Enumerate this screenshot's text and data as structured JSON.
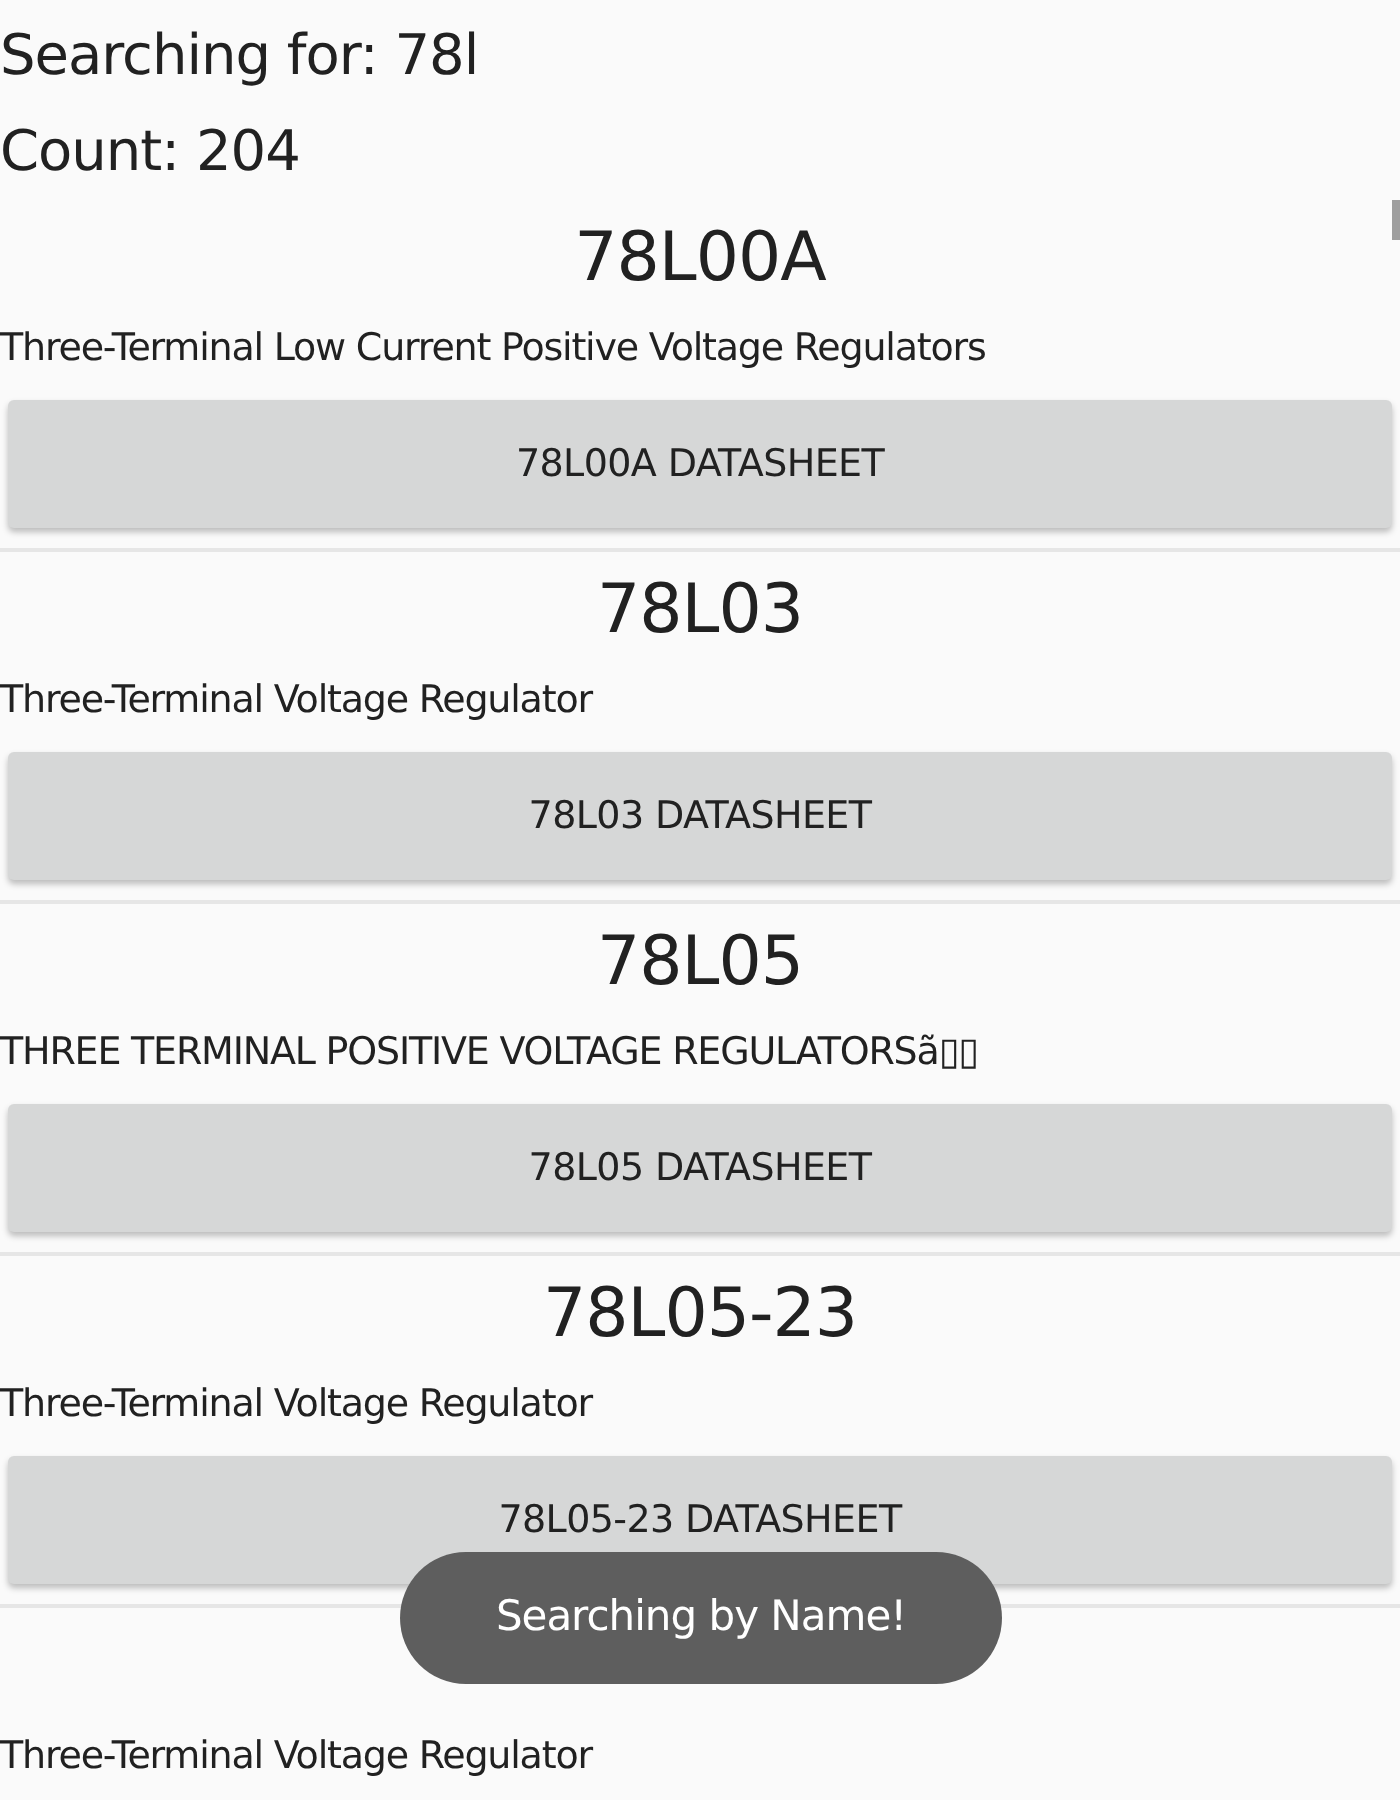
{
  "header": {
    "search_label": "Searching for: 78l",
    "count_label": "Count: 204"
  },
  "items": [
    {
      "title": "78L00A",
      "description": "Three-Terminal Low Current Positive Voltage Regulators",
      "button": "78L00A DATASHEET"
    },
    {
      "title": "78L03",
      "description": "Three-Terminal Voltage Regulator",
      "button": "78L03 DATASHEET"
    },
    {
      "title": "78L05",
      "description": "THREE TERMINAL POSITIVE VOLTAGE REGULATORSã▯▯",
      "button": "78L05 DATASHEET"
    },
    {
      "title": "78L05-23",
      "description": "Three-Terminal Voltage Regulator",
      "button": "78L05-23 DATASHEET"
    },
    {
      "description": "Three-Terminal Voltage Regulator"
    }
  ],
  "toast": {
    "text": "Searching by Name!"
  }
}
